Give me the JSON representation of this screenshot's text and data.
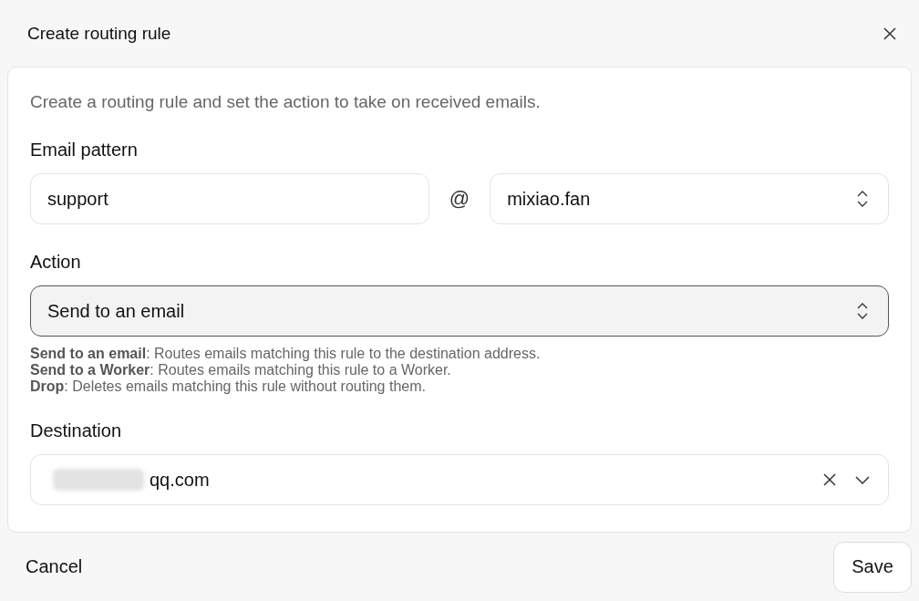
{
  "dialog": {
    "title": "Create routing rule"
  },
  "description": "Create a routing rule and set the action to take on received emails.",
  "email_pattern": {
    "label": "Email pattern",
    "local_part": "support",
    "separator": "@",
    "domain": "mixiao.fan"
  },
  "action": {
    "label": "Action",
    "value": "Send to an email",
    "focused": true,
    "help": [
      "**Send to an email**: Routes emails matching this rule to the destination address.",
      "**Send to a Worker**: Routes emails matching this rule to a Worker.",
      "**Drop**: Deletes emails matching this rule without routing them."
    ]
  },
  "destination": {
    "label": "Destination",
    "value": "qq.com",
    "redacted": true
  },
  "buttons": [
    {
      "label": "Cancel",
      "kind": "text"
    },
    {
      "label": "Save",
      "kind": "outlined"
    }
  ]
}
